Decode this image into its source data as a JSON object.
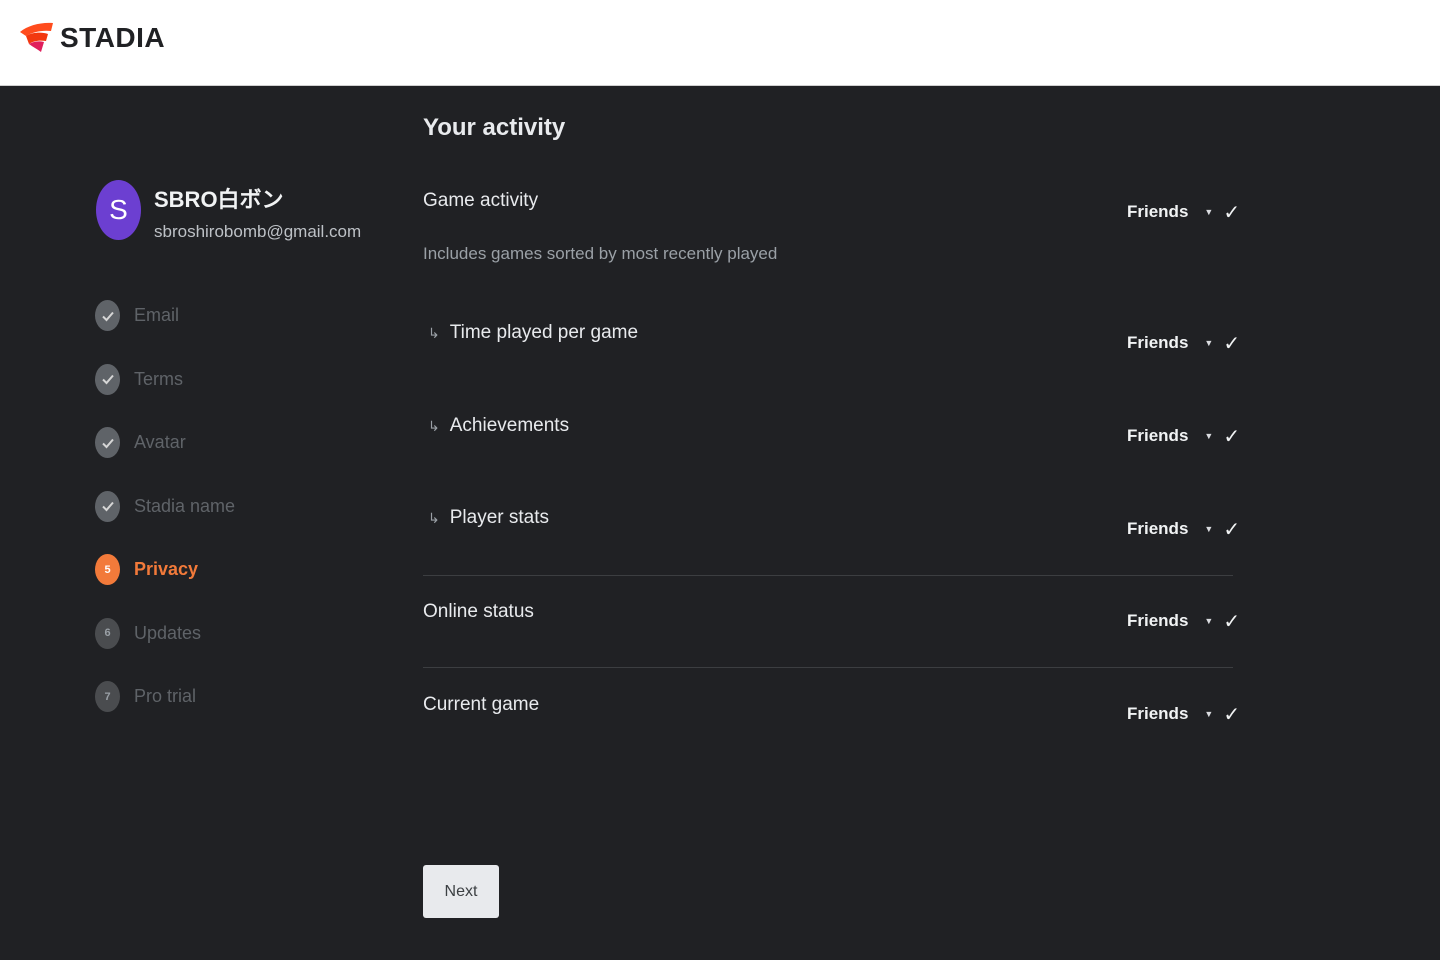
{
  "header": {
    "brand": "STADIA",
    "brand_colors": {
      "primary": "#ff4c1d",
      "accent": "#e01f5c"
    }
  },
  "profile": {
    "avatar_letter": "S",
    "avatar_color": "#6c3fd1",
    "name": "SBRO白ボン",
    "email": "sbroshirobomb@gmail.com"
  },
  "steps": [
    {
      "label": "Email",
      "status": "done"
    },
    {
      "label": "Terms",
      "status": "done"
    },
    {
      "label": "Avatar",
      "status": "done"
    },
    {
      "label": "Stadia name",
      "status": "done"
    },
    {
      "label": "Privacy",
      "status": "active",
      "number": "5"
    },
    {
      "label": "Updates",
      "status": "todo",
      "number": "6"
    },
    {
      "label": "Pro trial",
      "status": "todo",
      "number": "7"
    }
  ],
  "content": {
    "title": "Your activity",
    "game_activity": {
      "title": "Game activity",
      "description": "Includes games sorted by most recently played",
      "setting": "Friends"
    },
    "sub_settings": [
      {
        "label": "Time played per game",
        "setting": "Friends"
      },
      {
        "label": "Achievements",
        "setting": "Friends"
      },
      {
        "label": "Player stats",
        "setting": "Friends"
      }
    ],
    "online_status": {
      "title": "Online status",
      "setting": "Friends"
    },
    "current_game": {
      "title": "Current game",
      "setting": "Friends"
    }
  },
  "next_label": "Next",
  "icons": {
    "caret": "caret-down-icon",
    "check": "check-icon",
    "sub_arrow": "subdirectory-arrow-icon"
  },
  "accent_color": "#f27a3a"
}
